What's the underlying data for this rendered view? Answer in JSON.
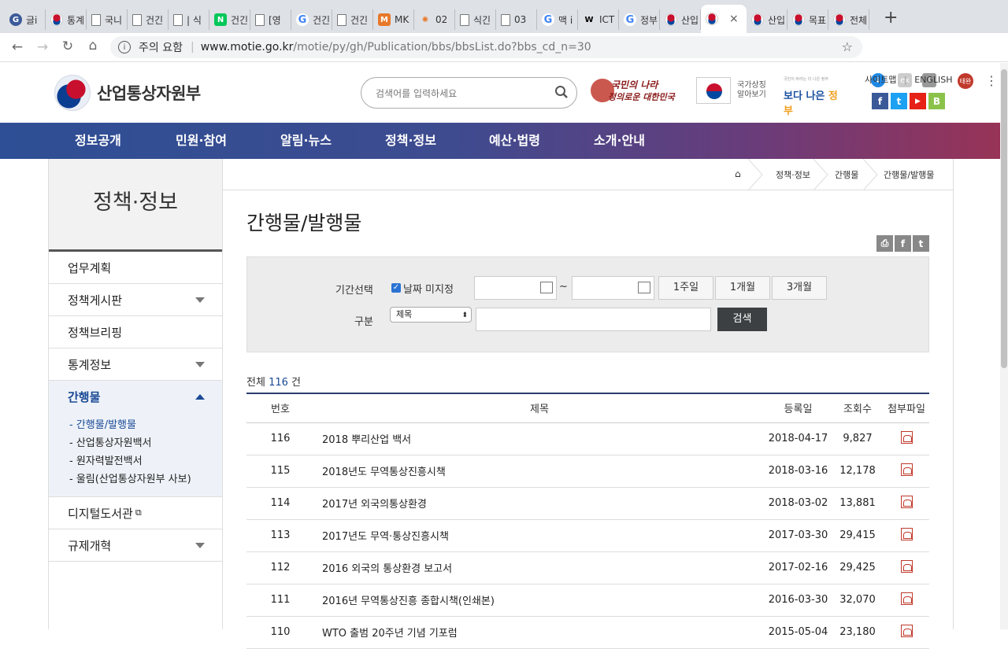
{
  "browser": {
    "tabs": [
      {
        "label": "글i",
        "icon": "globe-icon",
        "color": "#3b5a9a"
      },
      {
        "label": "통계",
        "icon": "taeguk-icon",
        "color": "#c8102e"
      },
      {
        "label": "국니",
        "icon": "document-icon",
        "color": "#777"
      },
      {
        "label": "건긴",
        "icon": "document-icon",
        "color": "#777"
      },
      {
        "label": "| 식",
        "icon": "document-icon",
        "color": "#777"
      },
      {
        "label": "건긴",
        "icon": "naver-icon",
        "color": "#03c75a"
      },
      {
        "label": "[영",
        "icon": "document-icon",
        "color": "#777"
      },
      {
        "label": "건긴",
        "icon": "google-icon",
        "color": "#4285f4"
      },
      {
        "label": "건긴",
        "icon": "document-icon",
        "color": "#777"
      },
      {
        "label": "MK",
        "icon": "mk-icon",
        "color": "#e8782a"
      },
      {
        "label": "02",
        "icon": "snowflake-icon",
        "color": "#e8782a"
      },
      {
        "label": "식긴",
        "icon": "document-icon",
        "color": "#777"
      },
      {
        "label": "03",
        "icon": "document-icon",
        "color": "#777"
      },
      {
        "label": "맥 i",
        "icon": "google-icon",
        "color": "#4285f4"
      },
      {
        "label": "ICT",
        "icon": "wikipedia-icon",
        "color": "#000"
      },
      {
        "label": "정부",
        "icon": "google-icon",
        "color": "#4285f4"
      },
      {
        "label": "산입",
        "icon": "taeguk-icon",
        "color": "#c8102e"
      },
      {
        "label": "",
        "icon": "taeguk-icon",
        "color": "#c8102e",
        "active": true
      },
      {
        "label": "산입",
        "icon": "taeguk-icon",
        "color": "#c8102e"
      },
      {
        "label": "목표",
        "icon": "taeguk-icon",
        "color": "#c8102e"
      },
      {
        "label": "전체",
        "icon": "taeguk-icon",
        "color": "#c8102e"
      }
    ],
    "close_glyph": "×",
    "newtab_glyph": "+",
    "security_label": "주의 요함",
    "url_host": "www.motie.go.kr",
    "url_path": "/motie/py/gh/Publication/bbs/bbsList.do?bbs_cd_n=30",
    "profile_label": "태완"
  },
  "header": {
    "logo_text": "산업통상자원부",
    "search_placeholder": "검색어를 입력하세요",
    "banner1_line1": "국민의 나라",
    "banner1_line2": "정의로운 대한민국",
    "banner2_line1": "국가상징",
    "banner2_line2": "알아보기",
    "banner3_small": "국민이 바라는 더 나은 정부",
    "banner3_part1": "보다 나은 ",
    "banner3_part2": "정부",
    "sitemap": "사이트맵",
    "sep": "|",
    "english": "ENGLISH",
    "social": [
      "f",
      "t",
      "▶",
      "B"
    ]
  },
  "gnb": [
    "정보공개",
    "민원·참여",
    "알림·뉴스",
    "정책·정보",
    "예산·법령",
    "소개·안내"
  ],
  "lnb": {
    "title": "정책·정보",
    "items": [
      {
        "label": "업무계획",
        "arrow": false
      },
      {
        "label": "정책게시판",
        "arrow": true
      },
      {
        "label": "정책브리핑",
        "arrow": false
      },
      {
        "label": "통계정보",
        "arrow": true
      },
      {
        "label": "간행물",
        "arrow": true,
        "open": true
      }
    ],
    "sub": [
      "간행물/발행물",
      "산업통상자원백서",
      "원자력발전백서",
      "울림(산업통상자원부 사보)"
    ],
    "sub_prefix": "- ",
    "items_after": [
      {
        "label": "디지털도서관",
        "arrow": false,
        "external": true
      },
      {
        "label": "규제개혁",
        "arrow": true
      }
    ]
  },
  "breadcrumb": [
    "정책·정보",
    "간행물",
    "간행물/발행물"
  ],
  "page_title": "간행물/발행물",
  "filter": {
    "period_label": "기간선택",
    "nodate_label": "날짜 미지정",
    "range_sep": "~",
    "periods": [
      "1주일",
      "1개월",
      "3개월"
    ],
    "type_label": "구분",
    "type_value": "제목",
    "search_button": "검색"
  },
  "list": {
    "total_prefix": "전체 ",
    "total": "116",
    "total_suffix": " 건",
    "columns": [
      "번호",
      "제목",
      "등록일",
      "조회수",
      "첨부파일"
    ],
    "rows": [
      {
        "no": "116",
        "title": "2018 뿌리산업 백서",
        "date": "2018-04-17",
        "views": "9,827"
      },
      {
        "no": "115",
        "title": "2018년도 무역통상진흥시책",
        "date": "2018-03-16",
        "views": "12,178"
      },
      {
        "no": "114",
        "title": "2017년 외국의통상환경",
        "date": "2018-03-02",
        "views": "13,881"
      },
      {
        "no": "113",
        "title": "2017년도 무역·통상진흥시책",
        "date": "2017-03-30",
        "views": "29,415"
      },
      {
        "no": "112",
        "title": "2016 외국의 통상환경 보고서",
        "date": "2017-02-16",
        "views": "29,425"
      },
      {
        "no": "111",
        "title": "2016년 무역통상진흥 종합시책(인쇄본)",
        "date": "2016-03-30",
        "views": "32,070"
      },
      {
        "no": "110",
        "title": "WTO 출범 20주년 기념 기포럼",
        "date": "2015-05-04",
        "views": "23,180"
      }
    ]
  }
}
